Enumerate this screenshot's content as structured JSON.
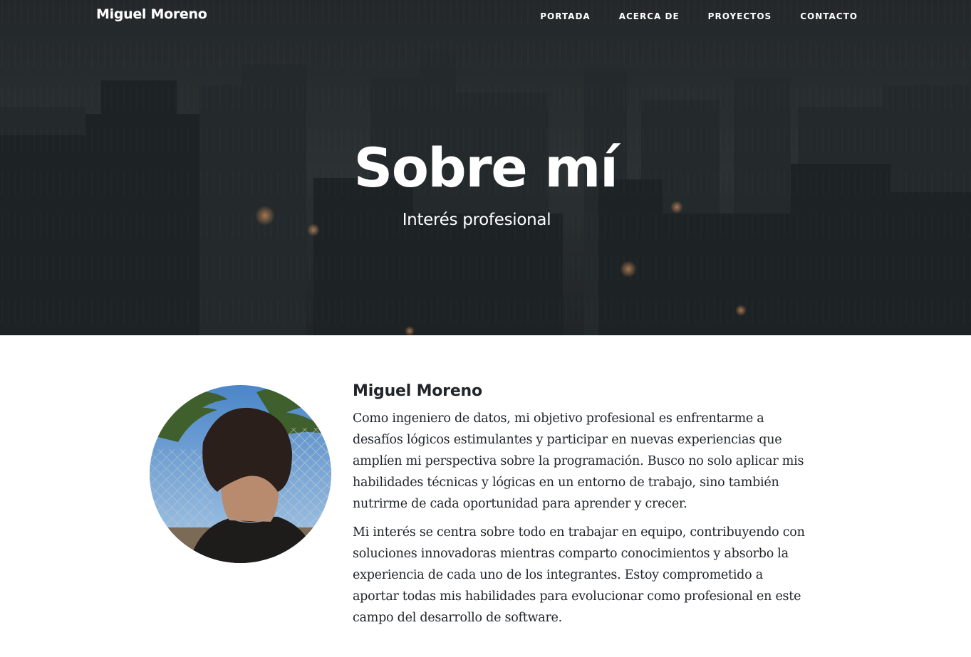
{
  "navbar": {
    "brand": "Miguel Moreno",
    "links": [
      {
        "label": "PORTADA"
      },
      {
        "label": "ACERCA DE"
      },
      {
        "label": "PROYECTOS"
      },
      {
        "label": "CONTACTO"
      }
    ]
  },
  "hero": {
    "title": "Sobre mí",
    "subtitle": "Interés profesional"
  },
  "about": {
    "name": "Miguel Moreno",
    "paragraphs": [
      "Como ingeniero de datos, mi objetivo profesional es enfrentarme a desafíos lógicos estimulantes y participar en nuevas experiencias que amplíen mi perspectiva sobre la programación. Busco no solo aplicar mis habilidades técnicas y lógicas en un entorno de trabajo, sino también nutrirme de cada oportunidad para aprender y crecer.",
      "Mi interés se centra sobre todo en trabajar en equipo, contribuyendo con soluciones innovadoras mientras comparto conocimientos y absorbo la experiencia de cada uno de los integrantes. Estoy comprometido a aportar todas mis habilidades para evolucionar como profesional en este campo del desarrollo de software."
    ]
  },
  "colors": {
    "hero_overlay": "#2f3536",
    "text_dark": "#212529",
    "nav_text": "#ffffff"
  }
}
